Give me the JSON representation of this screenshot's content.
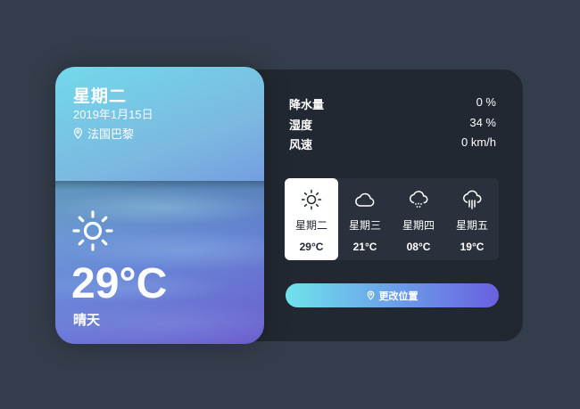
{
  "card": {
    "day_name": "星期二",
    "date": "2019年1月15日",
    "location": "法国巴黎",
    "location_icon": "map-pin-icon",
    "weather_icon": "sun-icon",
    "temperature": "29°C",
    "description": "晴天"
  },
  "stats": [
    {
      "label": "降水量",
      "value": "0 %"
    },
    {
      "label": "湿度",
      "value": "34 %"
    },
    {
      "label": "风速",
      "value": "0 km/h"
    }
  ],
  "forecast": [
    {
      "icon": "sun-icon",
      "day": "星期二",
      "temp": "29°C",
      "active": true
    },
    {
      "icon": "cloud-icon",
      "day": "星期三",
      "temp": "21°C",
      "active": false
    },
    {
      "icon": "cloud-snow-icon",
      "day": "星期四",
      "temp": "08°C",
      "active": false
    },
    {
      "icon": "cloud-rain-icon",
      "day": "星期五",
      "temp": "19°C",
      "active": false
    }
  ],
  "button": {
    "label": "更改位置",
    "icon": "map-pin-icon"
  },
  "colors": {
    "background": "#343d4b",
    "panel": "#222831",
    "forecast_bg": "#2a313c",
    "accent_start": "#70e3ec",
    "accent_end": "#6a60e0"
  }
}
